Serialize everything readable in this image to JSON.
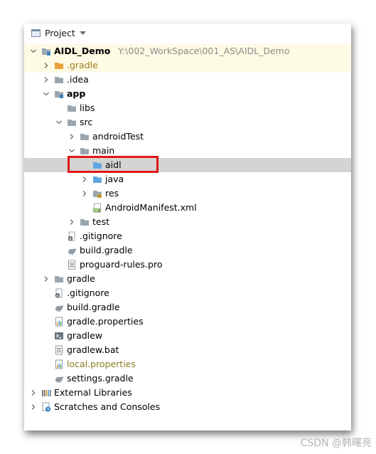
{
  "panel": {
    "title": "Project"
  },
  "tree": [
    {
      "label": "AIDL_Demo",
      "path": "Y:\\002_WorkSpace\\001_AS\\AIDL_Demo",
      "indent": 0,
      "arrow": "down",
      "icon": "module-icon",
      "bold": true,
      "highlight": "yellow"
    },
    {
      "label": ".gradle",
      "indent": 1,
      "arrow": "right",
      "icon": "folder-orange-icon",
      "color": "orange",
      "highlight": "yellow"
    },
    {
      "label": ".idea",
      "indent": 1,
      "arrow": "right",
      "icon": "folder-icon"
    },
    {
      "label": "app",
      "indent": 1,
      "arrow": "down",
      "icon": "module-icon",
      "bold": true
    },
    {
      "label": "libs",
      "indent": 2,
      "arrow": "none",
      "icon": "folder-icon"
    },
    {
      "label": "src",
      "indent": 2,
      "arrow": "down",
      "icon": "folder-icon"
    },
    {
      "label": "androidTest",
      "indent": 3,
      "arrow": "right",
      "icon": "folder-icon"
    },
    {
      "label": "main",
      "indent": 3,
      "arrow": "down",
      "icon": "folder-icon"
    },
    {
      "label": "aidl",
      "indent": 4,
      "arrow": "none",
      "icon": "folder-blue-icon",
      "highlight": "gray"
    },
    {
      "label": "java",
      "indent": 4,
      "arrow": "right",
      "icon": "folder-blue-icon"
    },
    {
      "label": "res",
      "indent": 4,
      "arrow": "right",
      "icon": "folder-res-icon"
    },
    {
      "label": "AndroidManifest.xml",
      "indent": 4,
      "arrow": "none",
      "icon": "manifest-icon"
    },
    {
      "label": "test",
      "indent": 3,
      "arrow": "right",
      "icon": "folder-icon"
    },
    {
      "label": ".gitignore",
      "indent": 2,
      "arrow": "none",
      "icon": "gitignore-icon"
    },
    {
      "label": "build.gradle",
      "indent": 2,
      "arrow": "none",
      "icon": "gradle-icon"
    },
    {
      "label": "proguard-rules.pro",
      "indent": 2,
      "arrow": "none",
      "icon": "text-file-icon"
    },
    {
      "label": "gradle",
      "indent": 1,
      "arrow": "right",
      "icon": "folder-icon"
    },
    {
      "label": ".gitignore",
      "indent": 1,
      "arrow": "none",
      "icon": "gitignore-icon"
    },
    {
      "label": "build.gradle",
      "indent": 1,
      "arrow": "none",
      "icon": "gradle-icon"
    },
    {
      "label": "gradle.properties",
      "indent": 1,
      "arrow": "none",
      "icon": "properties-icon"
    },
    {
      "label": "gradlew",
      "indent": 1,
      "arrow": "none",
      "icon": "terminal-icon"
    },
    {
      "label": "gradlew.bat",
      "indent": 1,
      "arrow": "none",
      "icon": "text-file-icon"
    },
    {
      "label": "local.properties",
      "indent": 1,
      "arrow": "none",
      "icon": "properties-icon",
      "color": "olive"
    },
    {
      "label": "settings.gradle",
      "indent": 1,
      "arrow": "none",
      "icon": "gradle-icon"
    },
    {
      "label": "External Libraries",
      "indent": 0,
      "arrow": "right",
      "icon": "libraries-icon"
    },
    {
      "label": "Scratches and Consoles",
      "indent": 0,
      "arrow": "right",
      "icon": "scratches-icon"
    }
  ],
  "watermark": "CSDN @韩曙亮",
  "colors": {
    "selection": "#d4d4d4",
    "highlight": "#fdfbe3",
    "callout": "#e01818"
  }
}
